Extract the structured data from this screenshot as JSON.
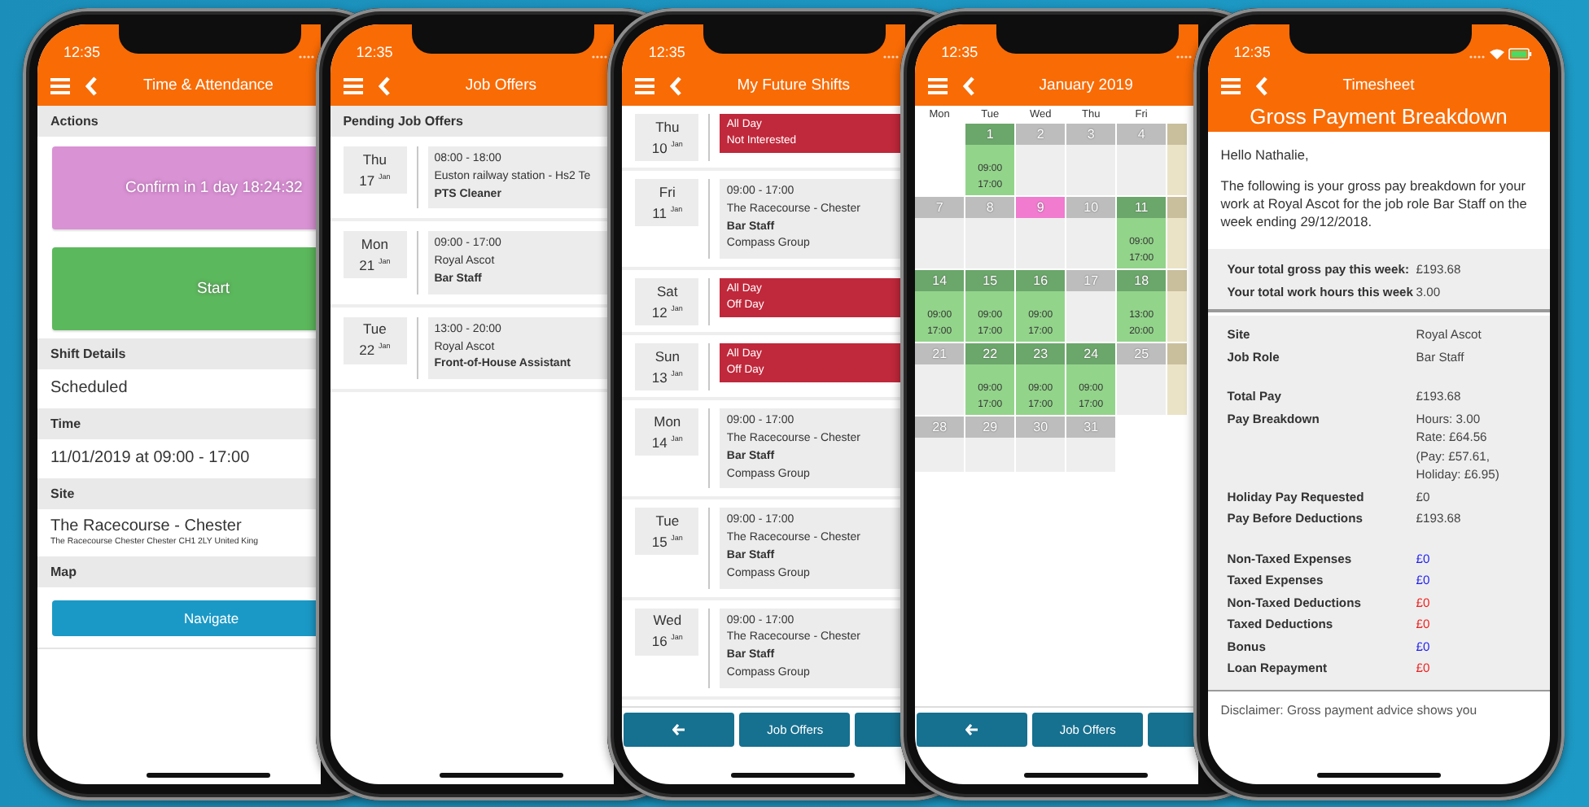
{
  "phones": [
    {
      "kind": "attendance",
      "time": "12:35",
      "title": "Time & Attendance",
      "blocks": [
        {
          "kind": "heading",
          "text": "Actions"
        },
        {
          "kind": "action",
          "text": "Confirm in 1 day 18:24:32",
          "color": "#d992d4"
        },
        {
          "kind": "action",
          "text": "Start",
          "color": "#5cb85c"
        },
        {
          "kind": "heading",
          "text": "Shift Details"
        },
        {
          "kind": "value",
          "text": "Scheduled"
        },
        {
          "kind": "heading",
          "text": "Time"
        },
        {
          "kind": "value",
          "text": "11/01/2019 at 09:00 - 17:00"
        },
        {
          "kind": "heading",
          "text": "Site"
        },
        {
          "kind": "address",
          "text": "The Racecourse - Chester",
          "detail": "The Racecourse Chester Chester CH1 2LY United King"
        },
        {
          "kind": "heading",
          "text": "Map"
        },
        {
          "kind": "navigate",
          "text": "Navigate"
        }
      ]
    },
    {
      "kind": "offers",
      "time": "12:35",
      "title": "Job Offers",
      "heading": "Pending Job Offers",
      "offers": [
        {
          "weekday": "Thu",
          "day": "17",
          "month": "Jan",
          "hours": "08:00 - 18:00",
          "location": "Euston railway station - Hs2 Te",
          "role": "PTS Cleaner"
        },
        {
          "weekday": "Mon",
          "day": "21",
          "month": "Jan",
          "hours": "09:00 - 17:00",
          "location": "Royal Ascot",
          "role": "Bar Staff"
        },
        {
          "weekday": "Tue",
          "day": "22",
          "month": "Jan",
          "hours": "13:00 - 20:00",
          "location": "Royal Ascot",
          "role": "Front-of-House Assistant"
        }
      ]
    },
    {
      "kind": "shifts",
      "time": "12:35",
      "title": "My Future Shifts",
      "shifts": [
        {
          "kind": "absence",
          "weekday": "Thu",
          "day": "10",
          "month": "Jan",
          "lines": [
            "All Day",
            "Not Interested"
          ]
        },
        {
          "kind": "shift",
          "weekday": "Fri",
          "day": "11",
          "month": "Jan",
          "hours": "09:00 - 17:00",
          "location": "The Racecourse - Chester",
          "role": "Bar Staff",
          "company": "Compass Group"
        },
        {
          "kind": "absence",
          "weekday": "Sat",
          "day": "12",
          "month": "Jan",
          "lines": [
            "All Day",
            "Off Day"
          ]
        },
        {
          "kind": "absence",
          "weekday": "Sun",
          "day": "13",
          "month": "Jan",
          "lines": [
            "All Day",
            "Off Day"
          ]
        },
        {
          "kind": "shift",
          "weekday": "Mon",
          "day": "14",
          "month": "Jan",
          "hours": "09:00 - 17:00",
          "location": "The Racecourse - Chester",
          "role": "Bar Staff",
          "company": "Compass Group"
        },
        {
          "kind": "shift",
          "weekday": "Tue",
          "day": "15",
          "month": "Jan",
          "hours": "09:00 - 17:00",
          "location": "The Racecourse - Chester",
          "role": "Bar Staff",
          "company": "Compass Group"
        },
        {
          "kind": "shift",
          "weekday": "Wed",
          "day": "16",
          "month": "Jan",
          "hours": "09:00 - 17:00",
          "location": "The Racecourse - Chester",
          "role": "Bar Staff",
          "company": "Compass Group"
        }
      ],
      "footer": [
        {
          "kind": "back"
        },
        {
          "kind": "label",
          "label": "Job Offers"
        },
        {
          "kind": "blank"
        }
      ]
    },
    {
      "kind": "calendar",
      "time": "12:35",
      "title": "January 2019",
      "weekdays": [
        "Mon",
        "Tue",
        "Wed",
        "Thu",
        "Fri"
      ],
      "weeks": [
        [
          {
            "kind": "none"
          },
          {
            "kind": "shift",
            "day": "1",
            "start": "09:00",
            "end": "17:00"
          },
          {
            "kind": "free",
            "day": "2"
          },
          {
            "kind": "free",
            "day": "3"
          },
          {
            "kind": "free",
            "day": "4"
          },
          {
            "kind": "weekend"
          }
        ],
        [
          {
            "kind": "free",
            "day": "7"
          },
          {
            "kind": "free",
            "day": "8"
          },
          {
            "kind": "today",
            "day": "9"
          },
          {
            "kind": "free",
            "day": "10"
          },
          {
            "kind": "shift",
            "day": "11",
            "start": "09:00",
            "end": "17:00"
          },
          {
            "kind": "weekend"
          }
        ],
        [
          {
            "kind": "shift",
            "day": "14",
            "start": "09:00",
            "end": "17:00"
          },
          {
            "kind": "shift",
            "day": "15",
            "start": "09:00",
            "end": "17:00"
          },
          {
            "kind": "shift",
            "day": "16",
            "start": "09:00",
            "end": "17:00"
          },
          {
            "kind": "free",
            "day": "17"
          },
          {
            "kind": "shift",
            "day": "18",
            "start": "13:00",
            "end": "20:00"
          },
          {
            "kind": "weekend"
          }
        ],
        [
          {
            "kind": "free",
            "day": "21"
          },
          {
            "kind": "shift",
            "day": "22",
            "start": "09:00",
            "end": "17:00"
          },
          {
            "kind": "shift",
            "day": "23",
            "start": "09:00",
            "end": "17:00"
          },
          {
            "kind": "shift",
            "day": "24",
            "start": "09:00",
            "end": "17:00"
          },
          {
            "kind": "free",
            "day": "25"
          },
          {
            "kind": "weekend"
          }
        ],
        [
          {
            "kind": "free",
            "day": "28"
          },
          {
            "kind": "free",
            "day": "29"
          },
          {
            "kind": "free",
            "day": "30"
          },
          {
            "kind": "free",
            "day": "31"
          },
          {
            "kind": "none"
          },
          {
            "kind": "none"
          }
        ]
      ],
      "footer": [
        {
          "kind": "back"
        },
        {
          "kind": "label",
          "label": "Job Offers"
        },
        {
          "kind": "blank"
        }
      ]
    },
    {
      "kind": "timesheet",
      "time": "12:35",
      "title": "Timesheet",
      "subtitle": "Gross Payment Breakdown",
      "greeting": "Hello Nathalie,",
      "intro": "The following is your gross pay breakdown for your work at Royal Ascot for the job role Bar Staff on the week ending 29/12/2018.",
      "totals": [
        {
          "label": "Your total gross pay this week:",
          "value": "£193.68"
        },
        {
          "label": "Your total work hours this week",
          "value": "3.00"
        }
      ],
      "groups": [
        [
          {
            "label": "Site",
            "value": "Royal Ascot"
          },
          {
            "label": "Job Role",
            "value": "Bar Staff"
          }
        ],
        [
          {
            "label": "Total Pay",
            "value": "£193.68"
          },
          {
            "label": "Pay Breakdown",
            "lines": [
              "Hours: 3.00",
              "Rate: £64.56",
              "(Pay: £57.61,",
              "Holiday: £6.95)"
            ]
          },
          {
            "label": "Holiday Pay Requested",
            "value": "£0"
          },
          {
            "label": "Pay Before Deductions",
            "value": "£193.68"
          }
        ],
        [
          {
            "label": "Non-Taxed Expenses",
            "value": "£0",
            "color": "#1f1ff0"
          },
          {
            "label": "Taxed Expenses",
            "value": "£0",
            "color": "#1f1ff0"
          },
          {
            "label": "Non-Taxed Deductions",
            "value": "£0",
            "color": "#f01f1f"
          },
          {
            "label": "Taxed Deductions",
            "value": "£0",
            "color": "#f01f1f"
          },
          {
            "label": "Bonus",
            "value": "£0",
            "color": "#1f1ff0"
          },
          {
            "label": "Loan Repayment",
            "value": "£0",
            "color": "#f01f1f"
          }
        ]
      ],
      "disclaimer": "Disclaimer: Gross payment advice shows you"
    }
  ]
}
